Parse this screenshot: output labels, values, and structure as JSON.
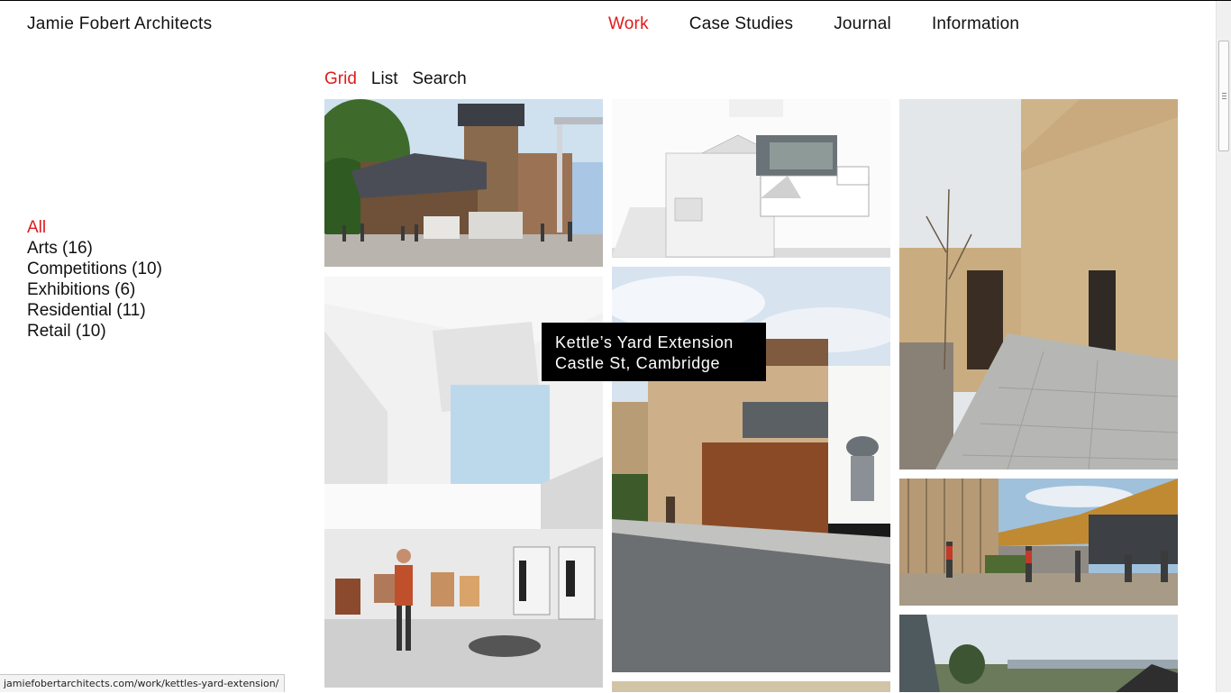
{
  "header": {
    "brand": "Jamie Fobert Architects",
    "nav": [
      {
        "label": "Work",
        "active": true
      },
      {
        "label": "Case Studies",
        "active": false
      },
      {
        "label": "Journal",
        "active": false
      },
      {
        "label": "Information",
        "active": false
      }
    ],
    "accent_color": "#e01b1b"
  },
  "view_tabs": [
    {
      "label": "Grid",
      "active": true
    },
    {
      "label": "List",
      "active": false
    },
    {
      "label": "Search",
      "active": false
    }
  ],
  "filters": [
    {
      "label": "All",
      "active": true
    },
    {
      "label": "Arts (16)",
      "active": false
    },
    {
      "label": "Competitions (10)",
      "active": false
    },
    {
      "label": "Exhibitions (6)",
      "active": false
    },
    {
      "label": "Residential (11)",
      "active": false
    },
    {
      "label": "Retail (10)",
      "active": false
    }
  ],
  "tooltip": {
    "title": "Kettle’s Yard Extension",
    "location": "Castle St, Cambridge"
  },
  "status_url": "jamiefobertarchitects.com/work/kettles-yard-extension/"
}
